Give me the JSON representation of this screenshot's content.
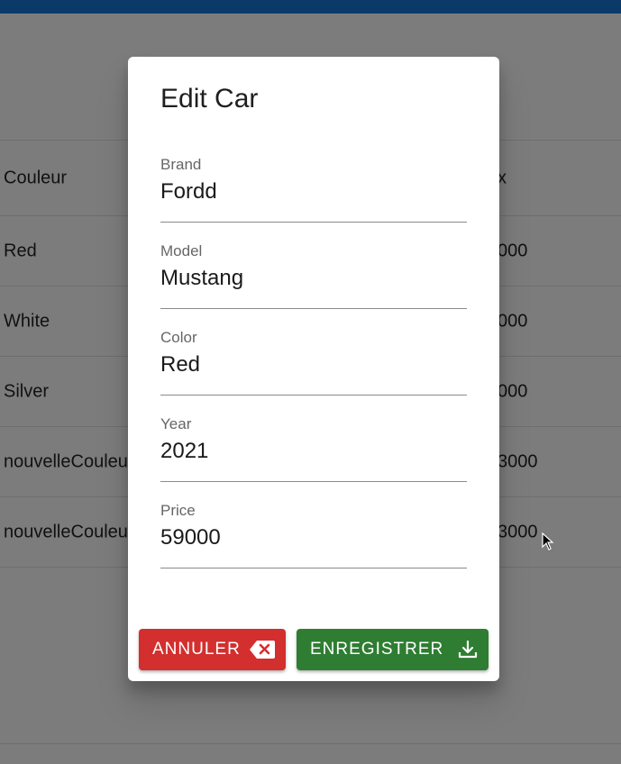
{
  "background": {
    "table": {
      "header": {
        "left": "Couleur",
        "right": "x"
      },
      "rows": [
        {
          "left": "Red",
          "right": "000"
        },
        {
          "left": "White",
          "right": "000"
        },
        {
          "left": "Silver",
          "right": "000"
        },
        {
          "left": "nouvelleCouleu",
          "right": "3000"
        },
        {
          "left": "nouvelleCouleu",
          "right": "3000"
        }
      ]
    }
  },
  "dialog": {
    "title": "Edit Car",
    "fields": [
      {
        "label": "Brand",
        "value": "Fordd"
      },
      {
        "label": "Model",
        "value": "Mustang"
      },
      {
        "label": "Color",
        "value": "Red"
      },
      {
        "label": "Year",
        "value": "2021"
      },
      {
        "label": "Price",
        "value": "59000"
      }
    ],
    "cancel_label": "ANNULER",
    "save_label": "ENREGISTRER",
    "cancel_icon": "backspace-icon",
    "save_icon": "download-icon"
  },
  "colors": {
    "topbar": "#0b3a6a",
    "cancel": "#d32f2f",
    "save": "#2e7d32",
    "overlay": "#7c7c7c"
  }
}
